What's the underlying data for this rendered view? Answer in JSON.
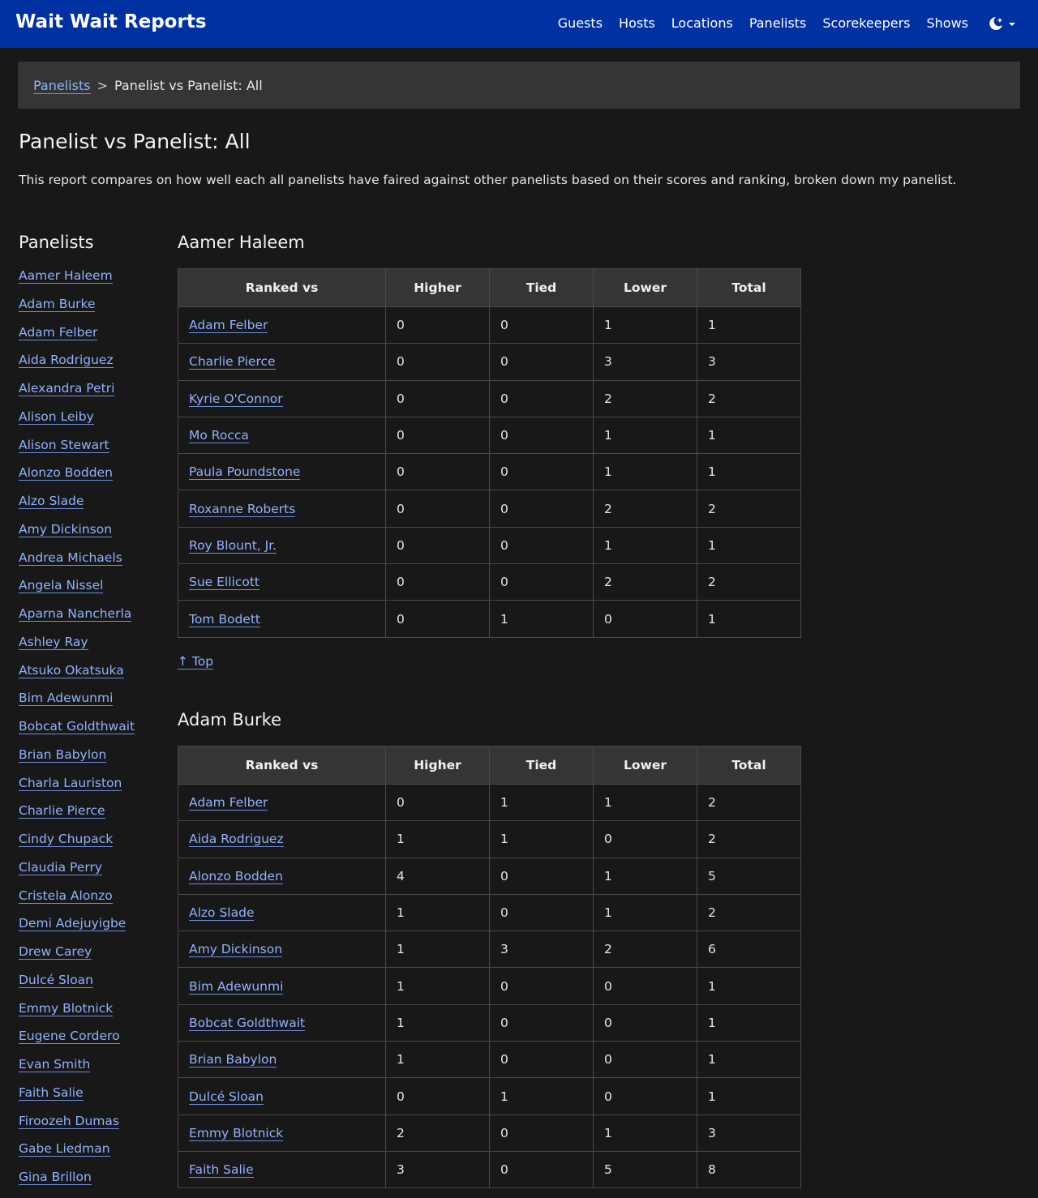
{
  "navbar": {
    "brand": "Wait Wait Reports",
    "links": [
      "Guests",
      "Hosts",
      "Locations",
      "Panelists",
      "Scorekeepers",
      "Shows"
    ],
    "theme_icon": "moon-icon"
  },
  "breadcrumb": {
    "parent": "Panelists",
    "separator": ">",
    "current": "Panelist vs Panelist: All"
  },
  "page": {
    "title": "Panelist vs Panelist: All",
    "description": "This report compares on how well each all panelists have faired against other panelists based on their scores and ranking, broken down my panelist."
  },
  "sidebar": {
    "heading": "Panelists",
    "items": [
      "Aamer Haleem",
      "Adam Burke",
      "Adam Felber",
      "Aida Rodriguez",
      "Alexandra Petri",
      "Alison Leiby",
      "Alison Stewart",
      "Alonzo Bodden",
      "Alzo Slade",
      "Amy Dickinson",
      "Andrea Michaels",
      "Angela Nissel",
      "Aparna Nancherla",
      "Ashley Ray",
      "Atsuko Okatsuka",
      "Bim Adewunmi",
      "Bobcat Goldthwait",
      "Brian Babylon",
      "Charla Lauriston",
      "Charlie Pierce",
      "Cindy Chupack",
      "Claudia Perry",
      "Cristela Alonzo",
      "Demi Adejuyigbe",
      "Drew Carey",
      "Dulcé Sloan",
      "Emmy Blotnick",
      "Eugene Cordero",
      "Evan Smith",
      "Faith Salie",
      "Firoozeh Dumas",
      "Gabe Liedman",
      "Gina Brillon"
    ]
  },
  "table_headers": [
    "Ranked vs",
    "Higher",
    "Tied",
    "Lower",
    "Total"
  ],
  "top_link": "↑ Top",
  "sections": [
    {
      "name": "Aamer Haleem",
      "rows": [
        [
          "Adam Felber",
          "0",
          "0",
          "1",
          "1"
        ],
        [
          "Charlie Pierce",
          "0",
          "0",
          "3",
          "3"
        ],
        [
          "Kyrie O'Connor",
          "0",
          "0",
          "2",
          "2"
        ],
        [
          "Mo Rocca",
          "0",
          "0",
          "1",
          "1"
        ],
        [
          "Paula Poundstone",
          "0",
          "0",
          "1",
          "1"
        ],
        [
          "Roxanne Roberts",
          "0",
          "0",
          "2",
          "2"
        ],
        [
          "Roy Blount, Jr.",
          "0",
          "0",
          "1",
          "1"
        ],
        [
          "Sue Ellicott",
          "0",
          "0",
          "2",
          "2"
        ],
        [
          "Tom Bodett",
          "0",
          "1",
          "0",
          "1"
        ]
      ]
    },
    {
      "name": "Adam Burke",
      "rows": [
        [
          "Adam Felber",
          "0",
          "1",
          "1",
          "2"
        ],
        [
          "Aida Rodriguez",
          "1",
          "1",
          "0",
          "2"
        ],
        [
          "Alonzo Bodden",
          "4",
          "0",
          "1",
          "5"
        ],
        [
          "Alzo Slade",
          "1",
          "0",
          "1",
          "2"
        ],
        [
          "Amy Dickinson",
          "1",
          "3",
          "2",
          "6"
        ],
        [
          "Bim Adewunmi",
          "1",
          "0",
          "0",
          "1"
        ],
        [
          "Bobcat Goldthwait",
          "1",
          "0",
          "0",
          "1"
        ],
        [
          "Brian Babylon",
          "1",
          "0",
          "0",
          "1"
        ],
        [
          "Dulcé Sloan",
          "0",
          "1",
          "0",
          "1"
        ],
        [
          "Emmy Blotnick",
          "2",
          "0",
          "1",
          "3"
        ],
        [
          "Faith Salie",
          "3",
          "0",
          "5",
          "8"
        ]
      ]
    }
  ]
}
